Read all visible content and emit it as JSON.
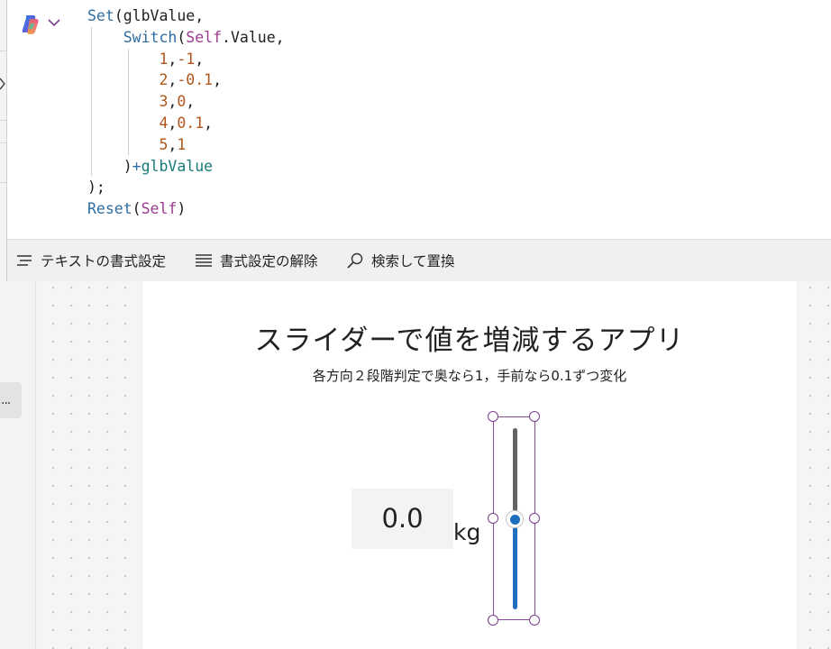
{
  "formula_editor": {
    "copilot_label": "Copilot",
    "code_lines": [
      [
        {
          "t": "fn",
          "v": "Set"
        },
        {
          "t": "pl",
          "v": "(glbValue,"
        }
      ],
      [
        {
          "t": "pl",
          "v": "    "
        },
        {
          "t": "fn",
          "v": "Switch"
        },
        {
          "t": "pl",
          "v": "("
        },
        {
          "t": "kw",
          "v": "Self"
        },
        {
          "t": "pl",
          "v": ".Value,"
        }
      ],
      [
        {
          "t": "pl",
          "v": "        "
        },
        {
          "t": "num",
          "v": "1"
        },
        {
          "t": "pl",
          "v": ","
        },
        {
          "t": "num",
          "v": "-1"
        },
        {
          "t": "pl",
          "v": ","
        }
      ],
      [
        {
          "t": "pl",
          "v": "        "
        },
        {
          "t": "num",
          "v": "2"
        },
        {
          "t": "pl",
          "v": ","
        },
        {
          "t": "num",
          "v": "-0.1"
        },
        {
          "t": "pl",
          "v": ","
        }
      ],
      [
        {
          "t": "pl",
          "v": "        "
        },
        {
          "t": "num",
          "v": "3"
        },
        {
          "t": "pl",
          "v": ","
        },
        {
          "t": "num",
          "v": "0"
        },
        {
          "t": "pl",
          "v": ","
        }
      ],
      [
        {
          "t": "pl",
          "v": "        "
        },
        {
          "t": "num",
          "v": "4"
        },
        {
          "t": "pl",
          "v": ","
        },
        {
          "t": "num",
          "v": "0.1"
        },
        {
          "t": "pl",
          "v": ","
        }
      ],
      [
        {
          "t": "pl",
          "v": "        "
        },
        {
          "t": "num",
          "v": "5"
        },
        {
          "t": "pl",
          "v": ","
        },
        {
          "t": "num",
          "v": "1"
        }
      ],
      [
        {
          "t": "pl",
          "v": "    )"
        },
        {
          "t": "fn",
          "v": "+"
        },
        {
          "t": "var",
          "v": "glbValue"
        }
      ],
      [
        {
          "t": "pl",
          "v": ");"
        }
      ],
      [
        {
          "t": "fn",
          "v": "Reset"
        },
        {
          "t": "pl",
          "v": "("
        },
        {
          "t": "kw",
          "v": "Self"
        },
        {
          "t": "pl",
          "v": ")"
        }
      ]
    ],
    "toolbar": {
      "format_text_label": "テキストの書式設定",
      "remove_format_label": "書式設定の解除",
      "find_replace_label": "検索して置換"
    }
  },
  "left_panel": {
    "more_button_label": "..."
  },
  "app": {
    "title": "スライダーで値を増減するアプリ",
    "subtitle": "各方向２段階判定で奥なら1，手前なら0.1ずつ変化",
    "value_display": "0.0",
    "unit": "kg",
    "slider": {
      "orientation": "vertical",
      "min": 1,
      "max": 5,
      "value": 3,
      "fill_color": "#1f6fbe",
      "rail_color": "#636363",
      "selection_color": "#8a4a9a"
    }
  },
  "colors": {
    "function": "#2e6da4",
    "keyword": "#9b3b8f",
    "number": "#b0561b",
    "variable": "#1a7a7a"
  }
}
